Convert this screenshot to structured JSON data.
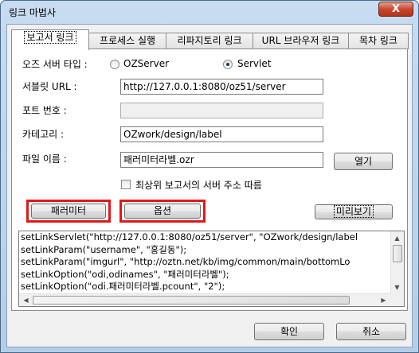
{
  "window": {
    "title": "링크 마법사",
    "close_glyph": "X"
  },
  "tabs": [
    {
      "label": "보고서 링크"
    },
    {
      "label": "프로세스 실행"
    },
    {
      "label": "리파지토리 링크"
    },
    {
      "label": "URL 브라우저 링크"
    },
    {
      "label": "목차 링크"
    }
  ],
  "form": {
    "server_type_label": "오즈 서버 타입 :",
    "option_ozserver": "OZServer",
    "option_servlet": "Servlet",
    "selected_server_type": "Servlet",
    "servlet_url_label": "서블릿 URL :",
    "servlet_url_value": "http://127.0.0.1:8080/oz51/server",
    "port_label": "포트 번호 :",
    "port_value": "",
    "category_label": "카테고리 :",
    "category_value": "OZwork/design/label",
    "filename_label": "파일 이름 :",
    "filename_value": "패러미터라벨.ozr",
    "open_button": "열기",
    "follow_parent_checkbox": "최상위 보고서의 서버 주소 따름",
    "follow_parent_checked": false
  },
  "actions": {
    "parameter_button": "패러미터",
    "option_button": "옵션",
    "preview_button": "미리보기"
  },
  "script_lines": [
    "setLinkServlet(\"http://127.0.0.1:8080/oz51/server\", \"OZwork/design/label",
    "setLinkParam(\"username\", \"홍길동\");",
    "setLinkParam(\"imgurl\", \"http://oztn.net/kb/img/common/main/bottomLo",
    "setLinkOption(\"odi,odinames\", \"패러미터라벨\");",
    "setLinkOption(\"odi.패러미터라벨.pcount\", \"2\");"
  ],
  "footer": {
    "ok_button": "확인",
    "cancel_button": "취소"
  },
  "colors": {
    "highlight_frame": "#e01818"
  }
}
